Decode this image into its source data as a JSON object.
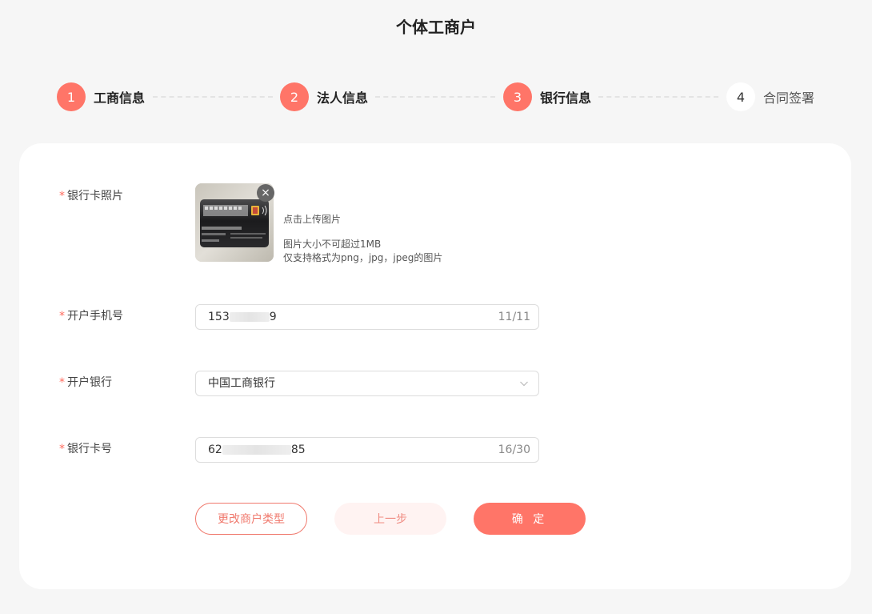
{
  "page": {
    "title": "个体工商户"
  },
  "steps": [
    {
      "number": "1",
      "label": "工商信息",
      "status": "done"
    },
    {
      "number": "2",
      "label": "法人信息",
      "status": "done"
    },
    {
      "number": "3",
      "label": "银行信息",
      "status": "active"
    },
    {
      "number": "4",
      "label": "合同签署",
      "status": "pending"
    }
  ],
  "form": {
    "required_mark": "*",
    "bank_card_photo": {
      "label": "银行卡照片",
      "remove_symbol": "×",
      "hint_upload": "点击上传图片",
      "hint_size": "图片大小不可超过1MB",
      "hint_format": "仅支持格式为png，jpg，jpeg的图片"
    },
    "phone": {
      "label": "开户手机号",
      "prefix": "153",
      "suffix": "9",
      "counter": "11/11"
    },
    "bank": {
      "label": "开户银行",
      "value": "中国工商银行"
    },
    "card_number": {
      "label": "银行卡号",
      "prefix": "62",
      "suffix": "85",
      "counter": "16/30"
    }
  },
  "buttons": {
    "change_type": "更改商户类型",
    "previous": "上一步",
    "confirm": "确 定"
  },
  "colors": {
    "accent": "#ff7568",
    "background": "#f6f6f6",
    "card": "#ffffff"
  },
  "icons": {
    "remove": "close-icon",
    "dropdown": "chevron-down-icon"
  }
}
